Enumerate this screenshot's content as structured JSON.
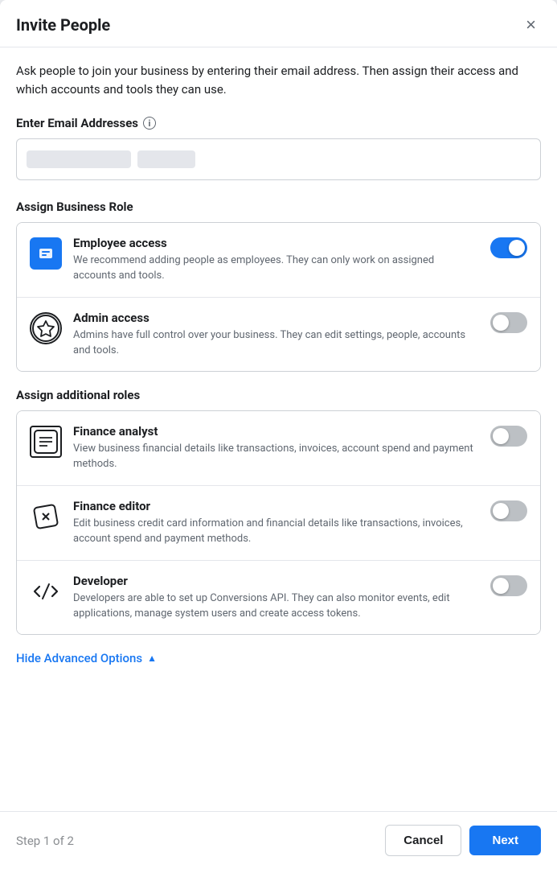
{
  "modal": {
    "title": "Invite People",
    "close_label": "×",
    "description": "Ask people to join your business by entering their email address. Then assign their access and which accounts and tools they can use."
  },
  "email_section": {
    "label": "Enter Email Addresses",
    "info_icon": "i",
    "placeholder": ""
  },
  "business_role_section": {
    "label": "Assign Business Role",
    "roles": [
      {
        "name": "Employee access",
        "description": "We recommend adding people as employees. They can only work on assigned accounts and tools.",
        "toggle_state": "on",
        "icon_type": "employee"
      },
      {
        "name": "Admin access",
        "description": "Admins have full control over your business. They can edit settings, people, accounts and tools.",
        "toggle_state": "off",
        "icon_type": "admin"
      }
    ]
  },
  "additional_roles_section": {
    "label": "Assign additional roles",
    "roles": [
      {
        "name": "Finance analyst",
        "description": "View business financial details like transactions, invoices, account spend and payment methods.",
        "toggle_state": "off",
        "icon_type": "finance-analyst"
      },
      {
        "name": "Finance editor",
        "description": "Edit business credit card information and financial details like transactions, invoices, account spend and payment methods.",
        "toggle_state": "off",
        "icon_type": "finance-editor"
      },
      {
        "name": "Developer",
        "description": "Developers are able to set up Conversions API. They can also monitor events, edit applications, manage system users and create access tokens.",
        "toggle_state": "off",
        "icon_type": "developer"
      }
    ]
  },
  "advanced": {
    "label": "Hide Advanced Options",
    "icon": "▲"
  },
  "footer": {
    "step_label": "Step 1 of 2",
    "cancel_label": "Cancel",
    "next_label": "Next"
  }
}
